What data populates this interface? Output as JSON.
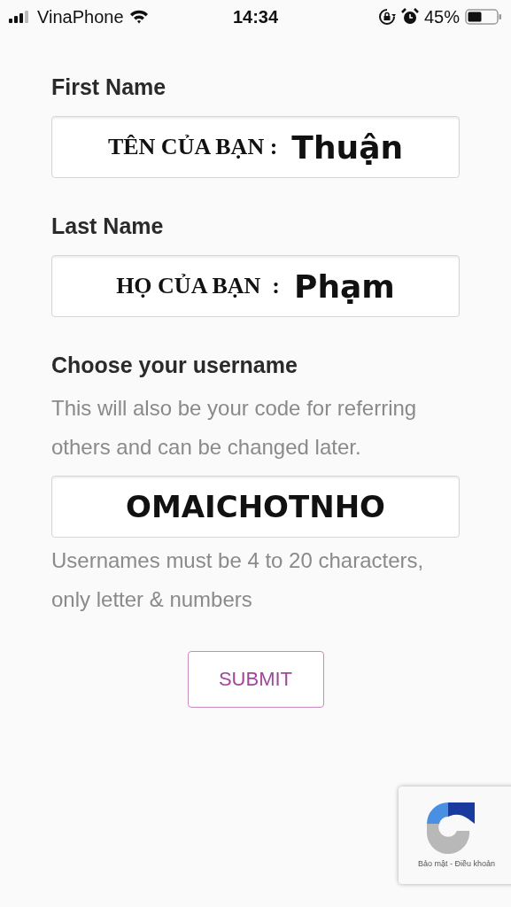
{
  "status_bar": {
    "carrier": "VinaPhone",
    "time": "14:34",
    "battery": "45%"
  },
  "form": {
    "fields": [
      {
        "kind": "annotated",
        "label": "First Name",
        "annotation": "TÊN CỦA BẠN :",
        "value": "Thuận"
      },
      {
        "kind": "annotated",
        "label": "Last Name",
        "annotation": "HỌ CỦA BẠN  :",
        "value": "Phạm"
      },
      {
        "kind": "plain",
        "label": "Choose your username",
        "description": "This will also be your code for referring others and can be changed later.",
        "value": "OMAICHOTNHO",
        "hint": "Usernames must be 4 to 20 characters, only letter & numbers"
      }
    ],
    "submit": "SUBMIT"
  },
  "recaptcha": {
    "links": "Bảo mật - Điều khoản"
  }
}
